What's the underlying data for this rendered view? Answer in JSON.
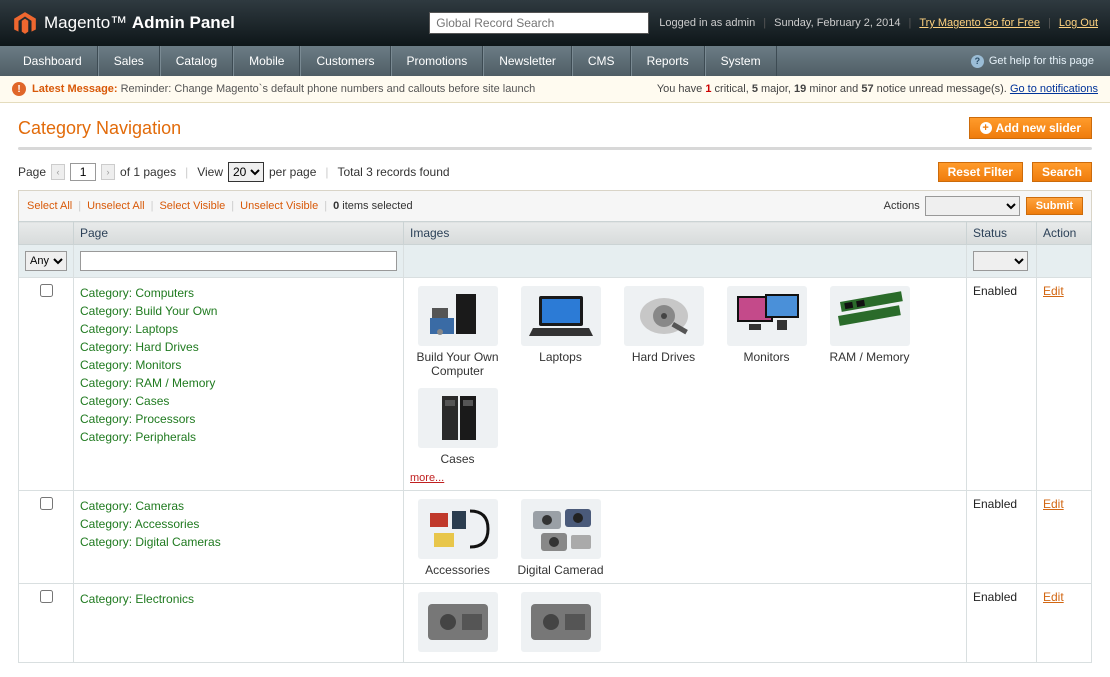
{
  "header": {
    "brand_main": "Magento",
    "brand_sub": "Admin Panel",
    "search_placeholder": "Global Record Search",
    "logged_in": "Logged in as admin",
    "date": "Sunday, February 2, 2014",
    "try_link": "Try Magento Go for Free",
    "logout": "Log Out"
  },
  "nav": {
    "items": [
      "Dashboard",
      "Sales",
      "Catalog",
      "Mobile",
      "Customers",
      "Promotions",
      "Newsletter",
      "CMS",
      "Reports",
      "System"
    ],
    "help": "Get help for this page"
  },
  "msg": {
    "label": "Latest Message:",
    "text": "Reminder: Change Magento`s default phone numbers and callouts before site launch",
    "you_have": "You have ",
    "c1": "1",
    "l1": " critical",
    "c2": "5",
    "l2": " major",
    "c3": "19",
    "l3": " minor and ",
    "c4": "57",
    "l4": " notice unread message(s). ",
    "notif_link": "Go to notifications"
  },
  "page": {
    "title": "Category Navigation",
    "add_btn": "Add new slider",
    "reset_btn": "Reset Filter",
    "search_btn": "Search",
    "submit_btn": "Submit"
  },
  "pager": {
    "page_label": "Page",
    "page_value": "1",
    "of_pages": "of 1 pages",
    "view_label": "View",
    "per_page_value": "20",
    "per_page_label": "per page",
    "total": "Total 3 records found"
  },
  "massaction": {
    "select_all": "Select All",
    "unselect_all": "Unselect All",
    "select_visible": "Select Visible",
    "unselect_visible": "Unselect Visible",
    "selected_count": "0",
    "selected_label": " items selected",
    "actions_label": "Actions"
  },
  "columns": {
    "check": "",
    "page": "Page",
    "images": "Images",
    "status": "Status",
    "action": "Action"
  },
  "filters": {
    "any_option": "Any"
  },
  "rows": [
    {
      "pages": [
        "Category: Computers",
        "Category: Build Your Own",
        "Category: Laptops",
        "Category: Hard Drives",
        "Category: Monitors",
        "Category: RAM / Memory",
        "Category: Cases",
        "Category: Processors",
        "Category: Peripherals"
      ],
      "images": [
        "Build Your Own Computer",
        "Laptops",
        "Hard Drives",
        "Monitors",
        "RAM / Memory",
        "Cases"
      ],
      "more": "more...",
      "status": "Enabled",
      "action": "Edit"
    },
    {
      "pages": [
        "Category: Cameras",
        "Category: Accessories",
        "Category: Digital Cameras"
      ],
      "images": [
        "Accessories",
        "Digital Camerad"
      ],
      "more": "",
      "status": "Enabled",
      "action": "Edit"
    },
    {
      "pages": [
        "Category: Electronics"
      ],
      "images": [
        "",
        ""
      ],
      "more": "",
      "status": "Enabled",
      "action": "Edit"
    }
  ]
}
